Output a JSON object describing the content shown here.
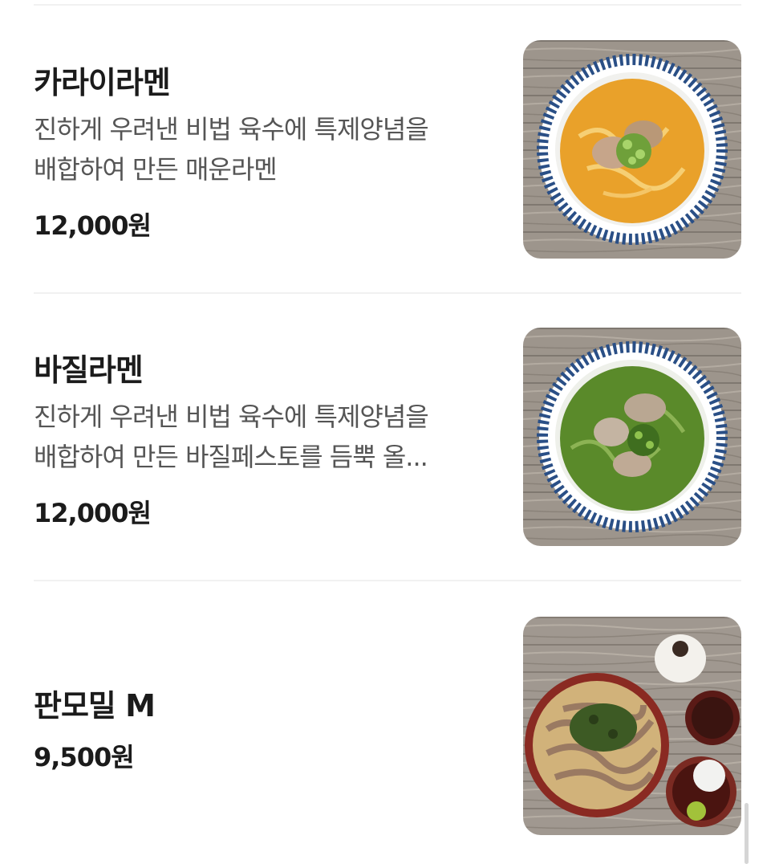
{
  "menu_items": [
    {
      "name": "카라이라멘",
      "description_lines": [
        "진하게 우려낸 비법 육수에 특제양념을",
        "배합하여 만든 매운라멘"
      ],
      "price": "12,000원",
      "image": "spicy-ramen-bowl-photo"
    },
    {
      "name": "바질라멘",
      "description_lines": [
        "진하게 우려낸 비법 육수에 특제양념을",
        "배합하여 만든 바질페스토를 듬뿍 올..."
      ],
      "price": "12,000원",
      "image": "basil-ramen-bowl-photo"
    },
    {
      "name": "판모밀 M",
      "description_lines": [],
      "price": "9,500원",
      "image": "cold-soba-tray-photo"
    }
  ],
  "colors": {
    "divider": "#f1f1f1",
    "title": "#1b1b1b",
    "description": "#555555",
    "spicy_broth": "#e9a12a",
    "basil_broth": "#5a8a2a",
    "soba": "#9a7a62",
    "bowl_stripe": "#2a4f86"
  }
}
